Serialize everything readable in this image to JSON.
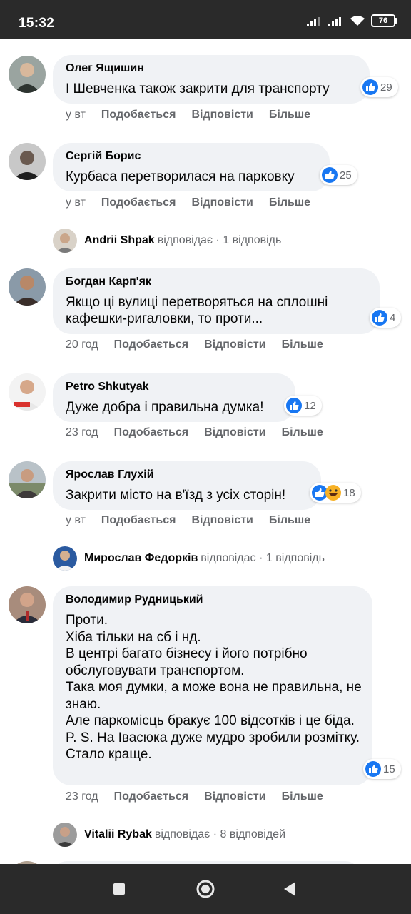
{
  "status_bar": {
    "time": "15:32",
    "battery_level": "76",
    "icons": [
      "signal-icon",
      "signal-icon",
      "wifi-icon",
      "battery-icon"
    ]
  },
  "comments": [
    {
      "author": "Олег Ящишин",
      "text": "І Шевченка також закрити для транспорту",
      "reactions": {
        "types": [
          "like"
        ],
        "count": "29"
      },
      "time": "у вт",
      "actions": [
        "Подобається",
        "Відповісти",
        "Більше"
      ]
    },
    {
      "author": "Сергій Борис",
      "text": "Курбаса перетворилася на парковку",
      "reactions": {
        "types": [
          "like"
        ],
        "count": "25"
      },
      "time": "у вт",
      "actions": [
        "Подобається",
        "Відповісти",
        "Більше"
      ]
    },
    {
      "author": "Богдан Карп'як",
      "text": "Якщо ці вулиці перетворяться на сплошні кафешки-ригаловки, то проти...",
      "reactions": {
        "types": [
          "like"
        ],
        "count": "4"
      },
      "time": "20 год",
      "actions": [
        "Подобається",
        "Відповісти",
        "Більше"
      ]
    },
    {
      "author": "Petro Shkutyak",
      "text": "Дуже добра і правильна думка!",
      "reactions": {
        "types": [
          "like"
        ],
        "count": "12"
      },
      "time": "23 год",
      "actions": [
        "Подобається",
        "Відповісти",
        "Більше"
      ]
    },
    {
      "author": "Ярослав Глухій",
      "text": "Закрити місто на в'їзд з усіх сторін!",
      "reactions": {
        "types": [
          "like",
          "haha"
        ],
        "count": "18"
      },
      "time": "у вт",
      "actions": [
        "Подобається",
        "Відповісти",
        "Більше"
      ]
    },
    {
      "author": "Володимир Рудницький",
      "text": "Проти.\nХіба тільки на сб і нд.\nВ центрі багато бізнесу і його потрібно обслуговувати транспортом.\nТака моя думки, а може вона не правильна, не знаю.\nАле паркомісць бракує 100 відсотків і це біда.\nP. S. На Івасюка дуже мудро зробили розмітку. Стало краще.",
      "reactions": {
        "types": [
          "like"
        ],
        "count": "15"
      },
      "time": "23 год",
      "actions": [
        "Подобається",
        "Відповісти",
        "Більше"
      ]
    }
  ],
  "replies": [
    {
      "name": "Andrii Shpak",
      "verb": "відповідає",
      "count": "1 відповідь"
    },
    {
      "name": "Мирослав Федорків",
      "verb": "відповідає",
      "count": "1 відповідь"
    },
    {
      "name": "Vitalii Rybak",
      "verb": "відповідає",
      "count": "8 відповідей"
    }
  ],
  "separator": " · ",
  "navigation": [
    "recents-square-icon",
    "home-circle-icon",
    "back-triangle-icon"
  ],
  "colors": {
    "bubble": "#f0f2f5",
    "secondary_text": "#65676b",
    "like_blue": "#1877f2",
    "system_bar": "#2a2a2a"
  }
}
